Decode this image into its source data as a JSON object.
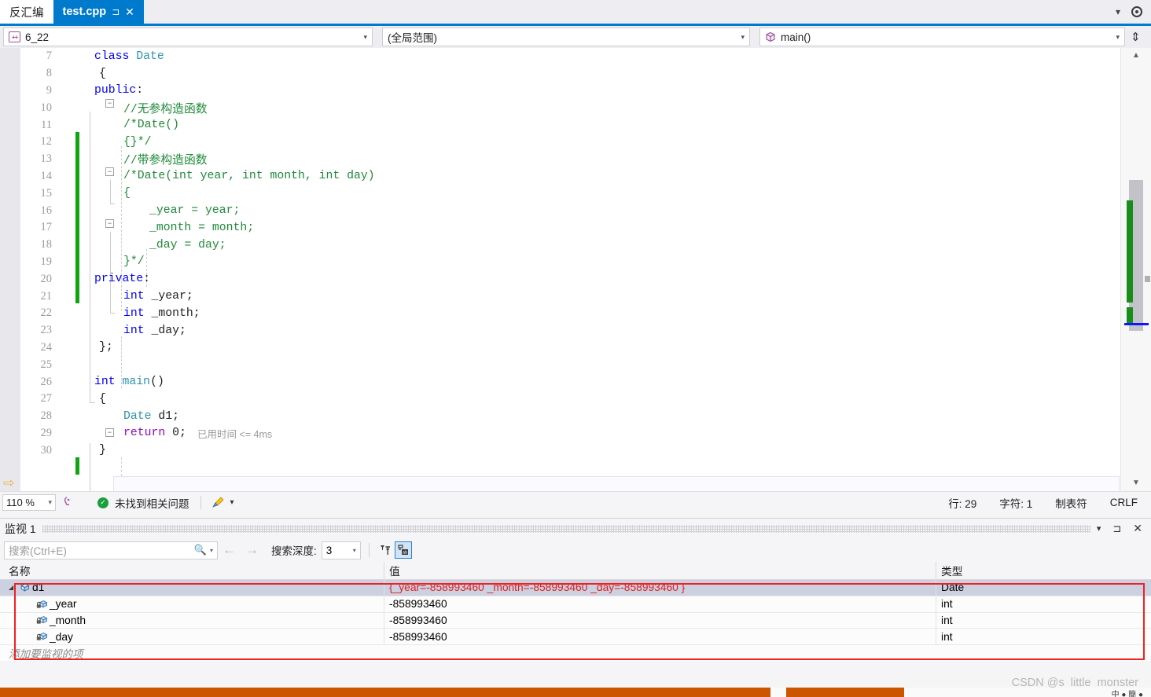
{
  "tabs": [
    {
      "label": "反汇编",
      "active": false,
      "pin": "",
      "close": ""
    },
    {
      "label": "test.cpp",
      "active": true,
      "pin": "⊐",
      "close": "✕"
    }
  ],
  "tabstrip": {
    "dropdown_icon": "▾",
    "settings_icon": "gear"
  },
  "navbar": {
    "project": "6_22",
    "scope": "(全局范围)",
    "member": "main()",
    "caret": "▾",
    "splitter": "⇕"
  },
  "code": {
    "lines": [
      {
        "n": "7",
        "text": "class Date"
      },
      {
        "n": "8",
        "text": "{"
      },
      {
        "n": "9",
        "text": "public:"
      },
      {
        "n": "10",
        "text": "//无参构造函数"
      },
      {
        "n": "11",
        "text": "/*Date()"
      },
      {
        "n": "12",
        "text": "{}*/"
      },
      {
        "n": "13",
        "text": "//带参构造函数"
      },
      {
        "n": "14",
        "text": "/*Date(int year, int month, int day)"
      },
      {
        "n": "15",
        "text": "{"
      },
      {
        "n": "16",
        "text": "_year = year;"
      },
      {
        "n": "17",
        "text": "_month = month;"
      },
      {
        "n": "18",
        "text": "_day = day;"
      },
      {
        "n": "19",
        "text": "}*/"
      },
      {
        "n": "20",
        "text": "private:"
      },
      {
        "n": "21",
        "text": "int _year;"
      },
      {
        "n": "22",
        "text": "int _month;"
      },
      {
        "n": "23",
        "text": "int _day;"
      },
      {
        "n": "24",
        "text": "};"
      },
      {
        "n": "25",
        "text": ""
      },
      {
        "n": "26",
        "text": "int main()"
      },
      {
        "n": "27",
        "text": "{"
      },
      {
        "n": "28",
        "text": "Date d1;"
      },
      {
        "n": "29",
        "text": "return 0;"
      },
      {
        "n": "30",
        "text": "}"
      }
    ],
    "elapsed_annotation": "已用时间 <= 4ms",
    "collapse_glyph": "−"
  },
  "status": {
    "zoom": "110 %",
    "zoom_caret": "▾",
    "issues": "未找到相关问题",
    "ok_mark": "✓",
    "broom_caret": "▾",
    "line_label": "行: 29",
    "char_label": "字符: 1",
    "tab_label": "制表符",
    "eol_label": "CRLF"
  },
  "watch": {
    "title": "监视 1",
    "dropdown_icon": "▾",
    "pin_icon": "⊐",
    "close_icon": "✕",
    "search_placeholder": "搜索(Ctrl+E)",
    "search_caret": "▾",
    "prev_icon": "←",
    "next_icon": "→",
    "depth_label": "搜索深度:",
    "depth_value": "3",
    "depth_caret": "▾",
    "columns": [
      "名称",
      "值",
      "类型"
    ],
    "rows": [
      {
        "indent": 0,
        "expander": "◢",
        "icon": "object",
        "name": "d1",
        "value": "{_year=-858993460 _month=-858993460 _day=-858993460 }",
        "type": "Date",
        "selected": true
      },
      {
        "indent": 1,
        "expander": "",
        "icon": "field",
        "name": "_year",
        "value": "-858993460",
        "type": "int",
        "selected": false
      },
      {
        "indent": 1,
        "expander": "",
        "icon": "field",
        "name": "_month",
        "value": "-858993460",
        "type": "int",
        "selected": false
      },
      {
        "indent": 1,
        "expander": "",
        "icon": "field",
        "name": "_day",
        "value": "-858993460",
        "type": "int",
        "selected": false
      }
    ],
    "add_item_placeholder": "添加要监视的项"
  },
  "watermark": "CSDN @s_little_monster",
  "colors": {
    "accent": "#007acc",
    "keyword": "#0000ff",
    "type": "#2b91af",
    "comment": "#1f8a39",
    "control": "#8f08c4",
    "changebar": "#10a510",
    "error_red": "#e02020",
    "annotation_box": "#f02020",
    "selected_row": "#ccd0e0"
  }
}
